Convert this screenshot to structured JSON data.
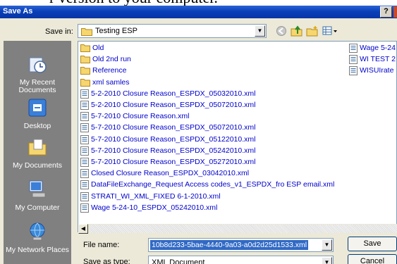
{
  "background_text": "r version to your computer.",
  "dialog": {
    "title": "Save As",
    "help_label": "?"
  },
  "save_in": {
    "label": "Save in:",
    "value": "Testing ESP"
  },
  "toolbar_icons": [
    "back-icon",
    "up-folder-icon",
    "new-folder-icon",
    "views-menu-icon"
  ],
  "places": [
    {
      "label": "My Recent Documents",
      "icon": "recent-documents-icon"
    },
    {
      "label": "Desktop",
      "icon": "desktop-icon"
    },
    {
      "label": "My Documents",
      "icon": "my-documents-icon"
    },
    {
      "label": "My Computer",
      "icon": "my-computer-icon"
    },
    {
      "label": "My Network Places",
      "icon": "network-places-icon"
    }
  ],
  "files_col1": [
    {
      "name": "Old",
      "type": "folder"
    },
    {
      "name": "Old 2nd run",
      "type": "folder"
    },
    {
      "name": "Reference",
      "type": "folder"
    },
    {
      "name": "xml samles",
      "type": "folder"
    },
    {
      "name": "5-2-2010 Closure Reason_ESPDX_05032010.xml",
      "type": "xml"
    },
    {
      "name": "5-2-2010 Closure Reason_ESPDX_05072010.xml",
      "type": "xml"
    },
    {
      "name": "5-7-2010 Closure Reason.xml",
      "type": "xml"
    },
    {
      "name": "5-7-2010 Closure Reason_ESPDX_05072010.xml",
      "type": "xml"
    },
    {
      "name": "5-7-2010 Closure Reason_ESPDX_05122010.xml",
      "type": "xml"
    },
    {
      "name": "5-7-2010 Closure Reason_ESPDX_05242010.xml",
      "type": "xml"
    },
    {
      "name": "5-7-2010 Closure Reason_ESPDX_05272010.xml",
      "type": "xml"
    },
    {
      "name": "Closed Closure Reason_ESPDX_03042010.xml",
      "type": "xml"
    },
    {
      "name": "DataFileExchange_Request Access codes_v1_ESPDX_fro ESP email.xml",
      "type": "xml"
    },
    {
      "name": "STRATI_WI_XML_FIXED 6-1-2010.xml",
      "type": "xml"
    },
    {
      "name": "Wage 5-24-10_ESPDX_05242010.xml",
      "type": "xml"
    }
  ],
  "files_col2": [
    {
      "name": "Wage 5-24",
      "type": "xml"
    },
    {
      "name": "WI TEST 2",
      "type": "xml"
    },
    {
      "name": "WISUIrate",
      "type": "xml"
    }
  ],
  "file_name": {
    "label": "File name:",
    "value": "10b8d233-5bae-4440-9a03-a0d2d25d1533.xml"
  },
  "save_as_type": {
    "label": "Save as type:",
    "value": "XML Document"
  },
  "buttons": {
    "save": "Save",
    "cancel": "Cancel"
  },
  "colors": {
    "titlebar": "#0a3fb8",
    "places_bar": "#808080",
    "file_text": "#0000cc",
    "selection": "#316ac5"
  }
}
